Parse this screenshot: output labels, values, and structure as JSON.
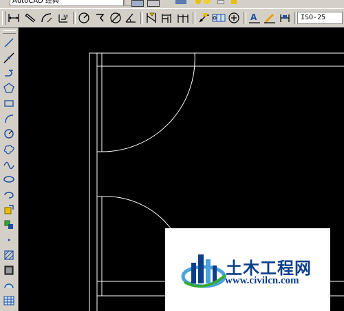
{
  "top_strip": {
    "workspace_label": "AutoCAD 经典"
  },
  "toolbar": {
    "dim_style_value": "ISO-25",
    "buttons": [
      {
        "name": "linear-dimension"
      },
      {
        "name": "aligned-dimension"
      },
      {
        "name": "arc-length-dimension"
      },
      {
        "name": "ordinate-dimension"
      },
      {
        "name": "radius-dimension"
      },
      {
        "name": "jogged-dimension"
      },
      {
        "name": "diameter-dimension"
      },
      {
        "name": "angular-dimension"
      },
      {
        "name": "quick-dimension"
      },
      {
        "name": "baseline-dimension"
      },
      {
        "name": "continue-dimension"
      },
      {
        "name": "quick-leader"
      },
      {
        "name": "tolerance"
      },
      {
        "name": "center-mark"
      },
      {
        "name": "dimension-edit"
      },
      {
        "name": "dimension-text-edit"
      },
      {
        "name": "dimension-update"
      }
    ]
  },
  "draw_toolbar": {
    "buttons": [
      {
        "name": "line"
      },
      {
        "name": "construction-line"
      },
      {
        "name": "polyline"
      },
      {
        "name": "polygon"
      },
      {
        "name": "rectangle"
      },
      {
        "name": "arc"
      },
      {
        "name": "circle"
      },
      {
        "name": "revision-cloud"
      },
      {
        "name": "spline"
      },
      {
        "name": "ellipse"
      },
      {
        "name": "ellipse-arc"
      },
      {
        "name": "insert-block"
      },
      {
        "name": "make-block"
      },
      {
        "name": "point"
      },
      {
        "name": "hatch"
      },
      {
        "name": "gradient"
      },
      {
        "name": "region"
      },
      {
        "name": "table"
      }
    ]
  },
  "watermark": {
    "title": "土木工程网",
    "url": "www.civilcn.com",
    "colors": {
      "blue": "#0b3f8a",
      "green": "#39a935",
      "light_blue": "#4aa3df"
    }
  },
  "colors": {
    "canvas_bg": "#000000",
    "ui_bg": "#d4d0c8",
    "drawing_lines": "#ffffff"
  }
}
